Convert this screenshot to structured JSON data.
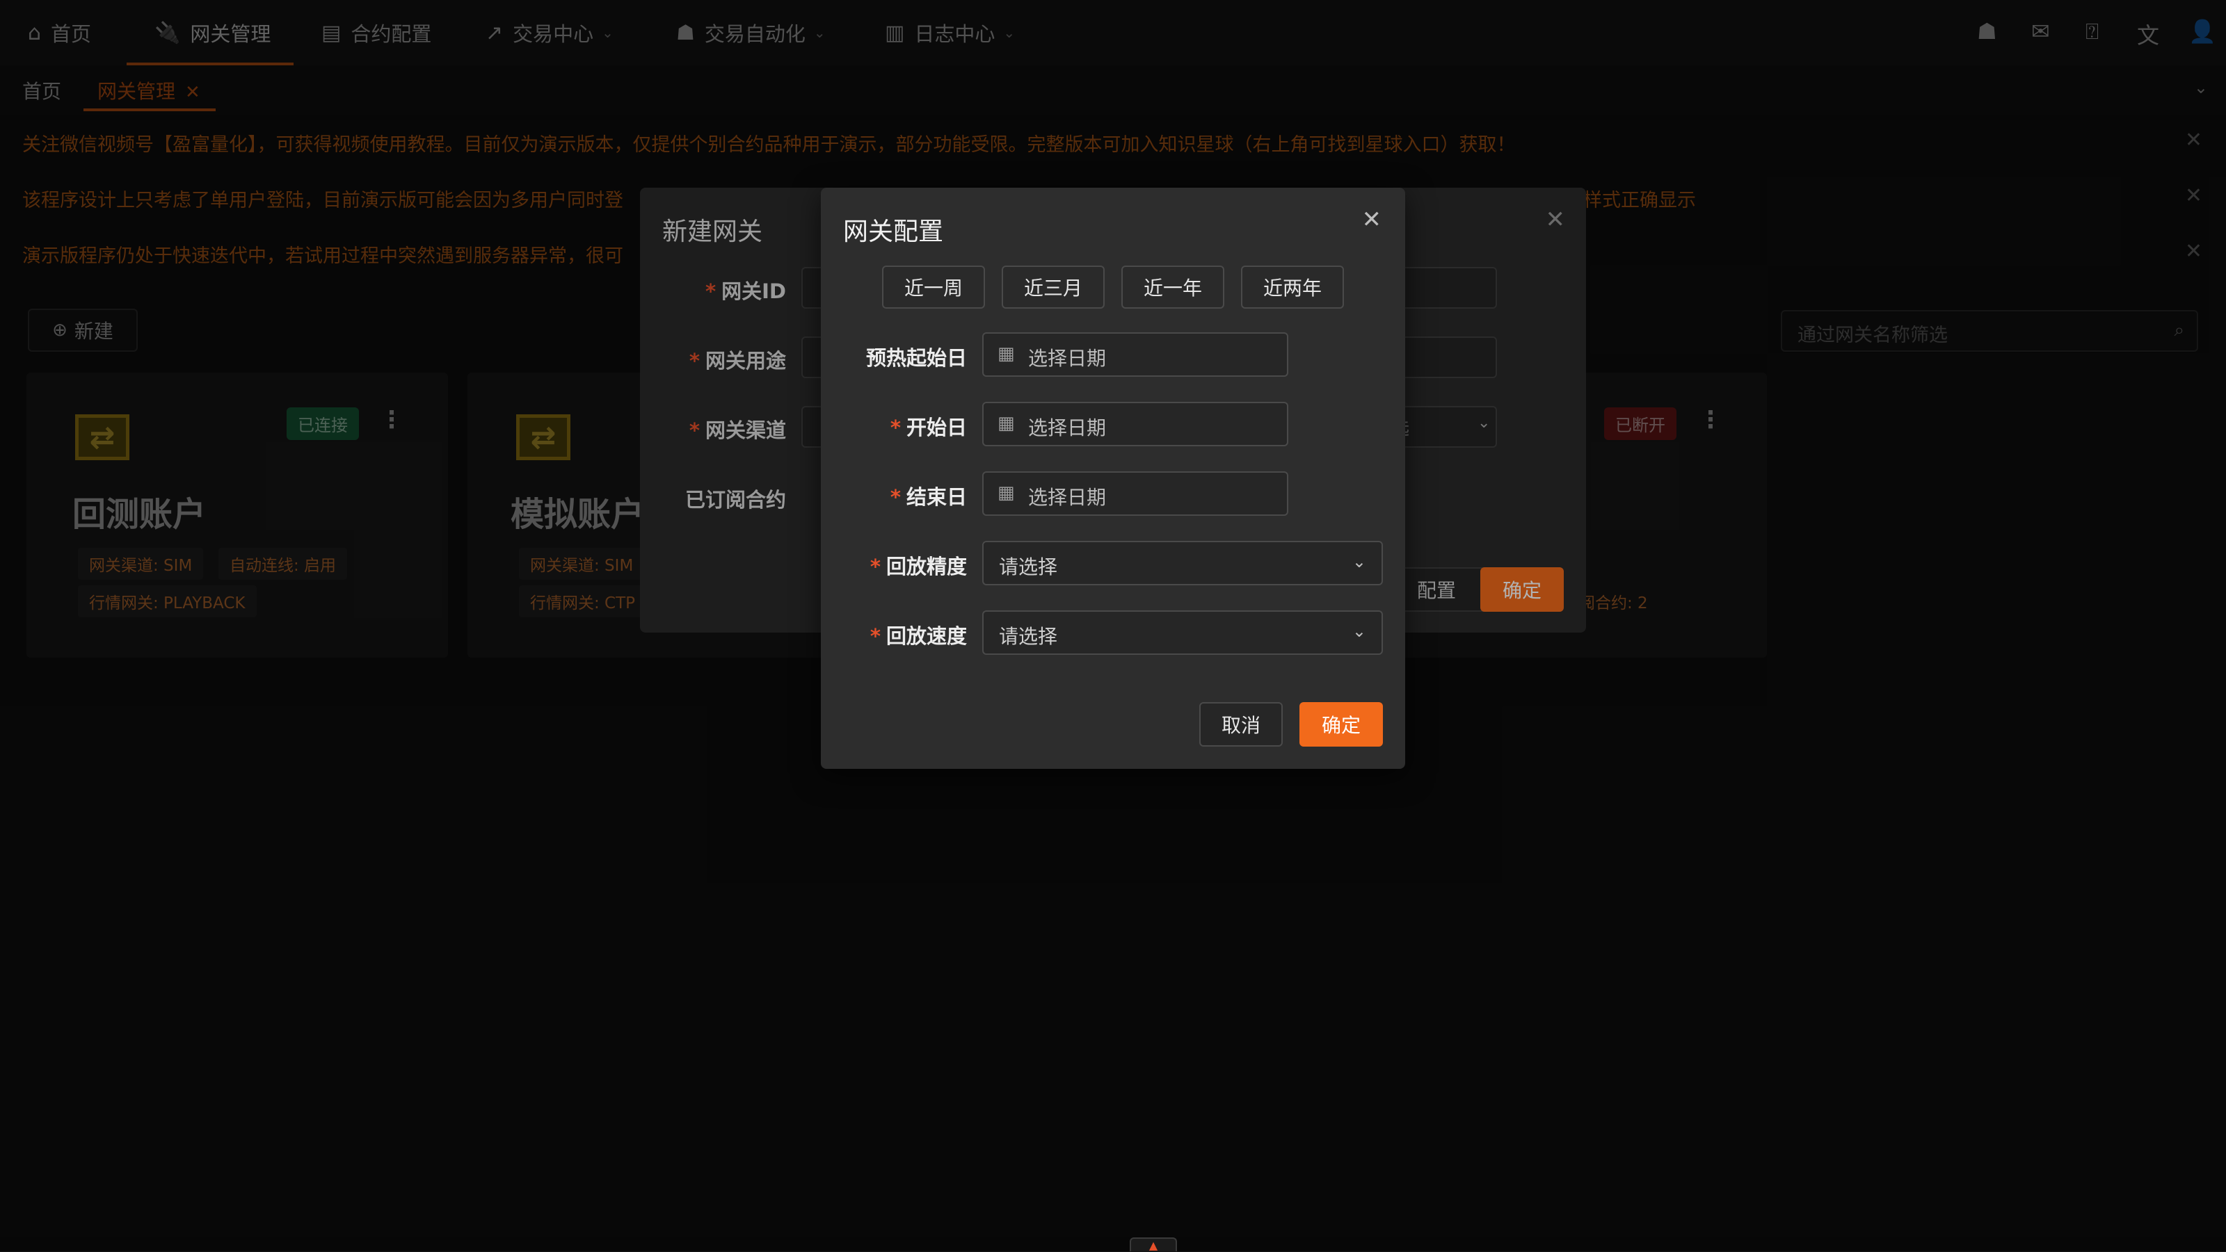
{
  "nav": {
    "items": [
      {
        "label": "首页",
        "icon": "home-icon"
      },
      {
        "label": "网关管理",
        "icon": "plug-icon"
      },
      {
        "label": "合约配置",
        "icon": "document-icon"
      },
      {
        "label": "交易中心",
        "icon": "trend-icon"
      },
      {
        "label": "交易自动化",
        "icon": "robot-icon"
      },
      {
        "label": "日志中心",
        "icon": "log-icon"
      }
    ],
    "right_icons": [
      "android-icon",
      "mail-icon",
      "help-icon",
      "translate-icon",
      "user-icon"
    ]
  },
  "tabs": [
    {
      "label": "首页"
    },
    {
      "label": "网关管理"
    }
  ],
  "notices": [
    "关注微信视频号【盈富量化】，可获得视频使用教程。目前仅为演示版本，仅提供个别合约品种用于演示，部分功能受限。完整版本可加入知识星球（右上角可找到星球入口）获取！",
    "该程序设计上只考虑了单用户登陆，目前演示版可能会因为多用户同时登",
    "演示版程序仍处于快速迭代中，若试用过程中突然遇到服务器异常，很可"
  ],
  "notice_tail_2": "样式正确显示",
  "toolbar": {
    "new_label": "新建",
    "search_placeholder": "通过网关名称筛选"
  },
  "cards": [
    {
      "title": "回测账户",
      "status": "已连接",
      "tags": [
        "网关渠道: SIM",
        "自动连线: 启用",
        "行情网关: PLAYBACK"
      ]
    },
    {
      "title": "模拟账户",
      "tags": [
        "网关渠道: SIM",
        "行情网关: CTP"
      ]
    },
    {
      "status": "已断开",
      "tags_tail": "阅合约: 2"
    }
  ],
  "back_modal": {
    "title": "新建网关",
    "labels": [
      "网关ID",
      "网关用途",
      "网关渠道",
      "已订阅合约"
    ],
    "select_text": "选",
    "config_label": "配置",
    "ok_label": "确定"
  },
  "front_modal": {
    "title": "网关配置",
    "ranges": [
      "近一周",
      "近三月",
      "近一年",
      "近两年"
    ],
    "fields": {
      "warmup": {
        "label": "预热起始日",
        "placeholder": "选择日期"
      },
      "start": {
        "label": "开始日",
        "placeholder": "选择日期"
      },
      "end": {
        "label": "结束日",
        "placeholder": "选择日期"
      },
      "precision": {
        "label": "回放精度",
        "placeholder": "请选择"
      },
      "speed": {
        "label": "回放速度",
        "placeholder": "请选择"
      }
    },
    "cancel_label": "取消",
    "ok_label": "确定"
  },
  "colors": {
    "accent": "#f26a1b",
    "background": "#141414",
    "success": "#1f7a4c",
    "danger": "#8a1f1f"
  }
}
